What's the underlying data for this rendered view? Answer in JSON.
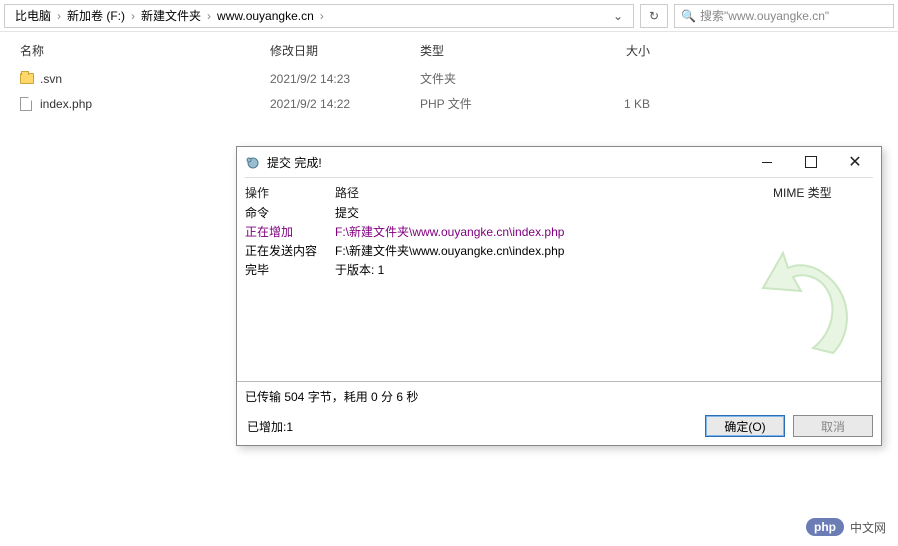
{
  "breadcrumb": {
    "items": [
      "比电脑",
      "新加卷 (F:)",
      "新建文件夹",
      "www.ouyangke.cn"
    ],
    "sep": "›"
  },
  "search": {
    "placeholder": "搜索\"www.ouyangke.cn\""
  },
  "columns": {
    "name": "名称",
    "date": "修改日期",
    "type": "类型",
    "size": "大小"
  },
  "files": [
    {
      "name": ".svn",
      "date": "2021/9/2 14:23",
      "type": "文件夹",
      "size": ""
    },
    {
      "name": "index.php",
      "date": "2021/9/2 14:22",
      "type": "PHP 文件",
      "size": "1 KB"
    }
  ],
  "dialog": {
    "title": "提交 完成!",
    "headers": {
      "op": "操作",
      "path": "路径",
      "mime": "MIME 类型"
    },
    "log": [
      {
        "op": "命令",
        "op_class": "op-cmd",
        "path": "提交",
        "path_class": "path-black"
      },
      {
        "op": "正在增加",
        "op_class": "op-add",
        "path": "F:\\新建文件夹\\www.ouyangke.cn\\index.php",
        "path_class": "path-purple"
      },
      {
        "op": "正在发送内容",
        "op_class": "op-send",
        "path": "F:\\新建文件夹\\www.ouyangke.cn\\index.php",
        "path_class": "path-black"
      },
      {
        "op": "完毕",
        "op_class": "op-done",
        "path": "于版本: 1",
        "path_class": "path-black"
      }
    ],
    "status": "已传输 504 字节，耗用 0 分 6 秒",
    "added": "已增加:1",
    "ok": "确定(O)",
    "cancel": "取消"
  },
  "watermark": {
    "badge": "php",
    "text": "中文网"
  }
}
